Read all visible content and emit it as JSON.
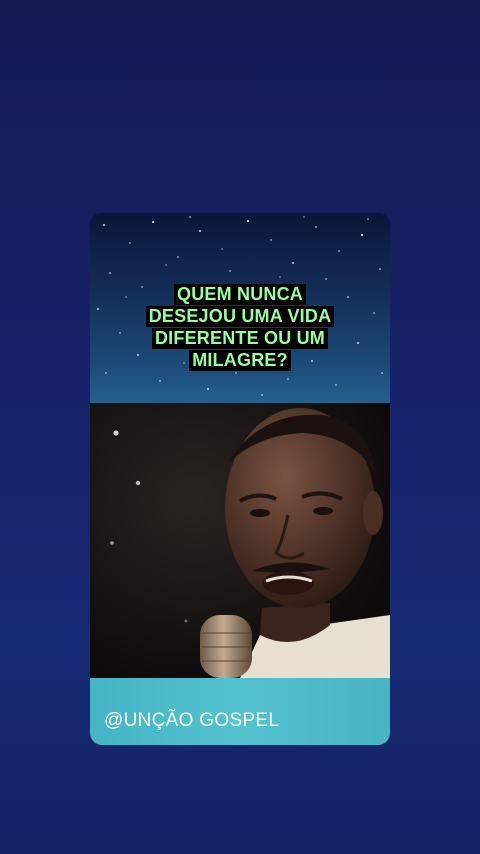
{
  "post": {
    "headline_lines": [
      "QUEM NUNCA",
      "DESEJOU UMA VIDA",
      "DIFERENTE OU UM",
      "MILAGRE?"
    ],
    "footer_handle": "@UNÇÃO GOSPEL"
  },
  "colors": {
    "background": "#17226a",
    "headline_text": "#9cff9f",
    "headline_highlight": "#000000",
    "footer_bar": "#4fbdcc"
  },
  "icons": [
    "microphone-icon"
  ]
}
